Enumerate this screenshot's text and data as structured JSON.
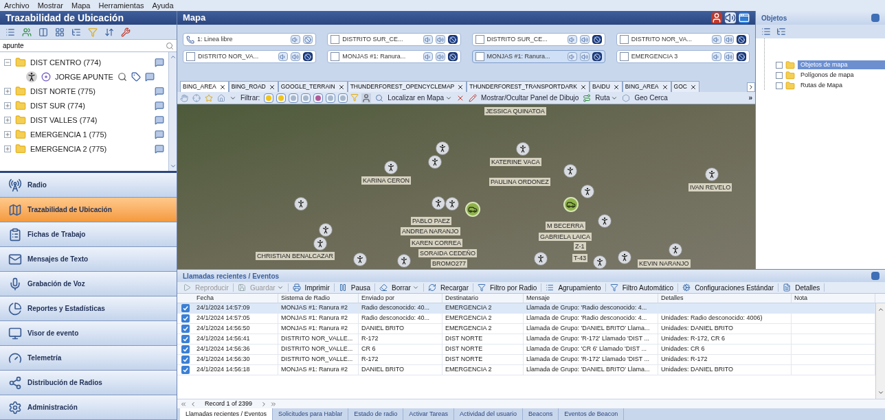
{
  "menu": [
    "Archivo",
    "Mostrar",
    "Mapa",
    "Herramientas",
    "Ayuda"
  ],
  "left_panel": {
    "title": "Trazabilidad de Ubicación",
    "search": {
      "value": "apunte"
    },
    "tree": [
      {
        "label": "DIST CENTRO (774)",
        "expanded": true,
        "children": [
          {
            "label": "JORGE APUNTE"
          }
        ]
      },
      {
        "label": "DIST NORTE (775)",
        "expanded": false
      },
      {
        "label": "DIST SUR (774)",
        "expanded": false
      },
      {
        "label": "DIST VALLES (774)",
        "expanded": false
      },
      {
        "label": "EMERGENCIA 1 (775)",
        "expanded": false
      },
      {
        "label": "EMERGENCIA 2 (775)",
        "expanded": false
      }
    ]
  },
  "nav": [
    {
      "label": "Radio",
      "selected": false
    },
    {
      "label": "Trazabilidad de Ubicación",
      "selected": true
    },
    {
      "label": "Fichas de Trabajo",
      "selected": false
    },
    {
      "label": "Mensajes de Texto",
      "selected": false
    },
    {
      "label": "Grabación de Voz",
      "selected": false
    },
    {
      "label": "Reportes y Estadísticas",
      "selected": false
    },
    {
      "label": "Visor de evento",
      "selected": false
    },
    {
      "label": "Telemetría",
      "selected": false
    },
    {
      "label": "Distribución de Radios",
      "selected": false
    },
    {
      "label": "Administración",
      "selected": false
    }
  ],
  "map_panel": {
    "title": "Mapa",
    "channels": [
      {
        "kind": "line",
        "label": "1: Linea libre",
        "selected": false
      },
      {
        "kind": "channel",
        "label": "DISTRITO SUR_CE...",
        "checked": false,
        "selected": false
      },
      {
        "kind": "channel",
        "label": "DISTRITO SUR_CE...",
        "checked": false,
        "selected": false
      },
      {
        "kind": "channel",
        "label": "DISTRITO NOR_VA...",
        "checked": false,
        "selected": false
      },
      {
        "kind": "channel",
        "label": "DISTRITO NOR_VA...",
        "checked": false,
        "selected": false
      },
      {
        "kind": "channel",
        "label": "MONJAS #1: Ranura...",
        "checked": false,
        "selected": false
      },
      {
        "kind": "channel",
        "label": "MONJAS #1: Ranura...",
        "checked": false,
        "selected": true
      },
      {
        "kind": "channel",
        "label": "EMERGENCIA 3",
        "checked": false,
        "selected": false
      }
    ],
    "tabs": [
      {
        "label": "BING_AREA",
        "selected": true
      },
      {
        "label": "BING_ROAD",
        "selected": false
      },
      {
        "label": "GOOGLE_TERRAIN",
        "selected": false
      },
      {
        "label": "THUNDERFOREST_OPENCYCLEMAP",
        "selected": false
      },
      {
        "label": "THUNDERFOREST_TRANSPORTDARK",
        "selected": false
      },
      {
        "label": "BAIDU",
        "selected": false
      },
      {
        "label": "BING_AREA",
        "selected": false
      },
      {
        "label": "GOC",
        "selected": false
      }
    ],
    "toolbar": [
      {
        "label": "Filtrar:",
        "dropdown": false
      },
      {
        "label": "Localizar en Mapa",
        "dropdown": true
      },
      {
        "label": "Mostrar/Ocultar Panel de Dibujo",
        "dropdown": false
      },
      {
        "label": "Ruta",
        "dropdown": true
      },
      {
        "label": "Geo Cerca",
        "dropdown": false
      },
      {
        "label": "»",
        "dropdown": false
      }
    ]
  },
  "map": {
    "labels": [
      "JESSICA QUINATOA",
      "KATERINE VACA",
      "KARINA CERON",
      "PAULINA ORDONEZ",
      "IVAN REVELO",
      "PABLO PAEZ",
      "ANDREA NARANJO",
      "KAREN CORREA",
      "SORAIDA CEDEÑO",
      "BROMO277",
      "M BECERRA",
      "GABRIELA LAICA",
      "Z-1",
      "T-43",
      "CHRISTIAN BENALCAZAR",
      "KEVIN NARANJO"
    ],
    "markers": [
      {
        "kind": "person"
      },
      {
        "kind": "person"
      },
      {
        "kind": "person"
      },
      {
        "kind": "person"
      },
      {
        "kind": "person"
      },
      {
        "kind": "person"
      },
      {
        "kind": "person"
      },
      {
        "kind": "person"
      },
      {
        "kind": "person"
      },
      {
        "kind": "person"
      },
      {
        "kind": "person"
      },
      {
        "kind": "person"
      },
      {
        "kind": "person"
      },
      {
        "kind": "person"
      },
      {
        "kind": "person"
      },
      {
        "kind": "person"
      },
      {
        "kind": "person"
      },
      {
        "kind": "person"
      },
      {
        "kind": "person"
      },
      {
        "kind": "vehicle"
      },
      {
        "kind": "vehicle"
      }
    ]
  },
  "objects_panel": {
    "title": "Objetos",
    "items": [
      {
        "label": "Objetos de mapa",
        "checked": false,
        "selected": true
      },
      {
        "label": "Polígonos de mapa",
        "checked": false,
        "selected": false
      },
      {
        "label": "Rutas de Mapa",
        "checked": false,
        "selected": false
      }
    ]
  },
  "events_panel": {
    "title": "Llamadas recientes / Eventos",
    "toolbar": [
      {
        "label": "Reproducir",
        "disabled": true,
        "dropdown": false
      },
      {
        "label": "Guardar",
        "disabled": true,
        "dropdown": true
      },
      {
        "label": "Imprimir",
        "disabled": false,
        "dropdown": false
      },
      {
        "label": "Pausa",
        "disabled": false,
        "dropdown": false
      },
      {
        "label": "Borrar",
        "disabled": false,
        "dropdown": true
      },
      {
        "label": "Recargar",
        "disabled": false,
        "dropdown": false
      },
      {
        "label": "Filtro por Radio",
        "disabled": false,
        "dropdown": false
      },
      {
        "label": "Agrupamiento",
        "disabled": false,
        "dropdown": false
      },
      {
        "label": "Filtro Automático",
        "disabled": false,
        "dropdown": false
      },
      {
        "label": "Configuraciones Estándar",
        "disabled": false,
        "dropdown": false
      },
      {
        "label": "Detalles",
        "disabled": false,
        "dropdown": false
      }
    ],
    "columns": [
      "Fecha",
      "Sistema de Radio",
      "Enviado por",
      "Destinatario",
      "Mensaje",
      "Detalles",
      "Nota"
    ],
    "rows": [
      {
        "selected": true,
        "cells": [
          "24/1/2024 14:57:09",
          "MONJAS #1: Ranura #2",
          "Radio desconocido: 40...",
          "EMERGENCIA 2",
          "Llamada de Grupo: 'Radio desconocido: 4..."
        ]
      },
      {
        "selected": false,
        "cells": [
          "24/1/2024 14:57:05",
          "MONJAS #1: Ranura #2",
          "Radio desconocido: 40...",
          "EMERGENCIA 2",
          "Llamada de Grupo: 'Radio desconocido: 4...",
          "Unidades: Radio desconocido: 4006)"
        ]
      },
      {
        "selected": false,
        "cells": [
          "24/1/2024 14:56:50",
          "MONJAS #1: Ranura #2",
          "DANIEL BRITO",
          "EMERGENCIA 2",
          "Llamada de Grupo: 'DANIEL BRITO' Llama...",
          "Unidades: DANIEL BRITO"
        ]
      },
      {
        "selected": false,
        "cells": [
          "24/1/2024 14:56:41",
          "DISTRITO NOR_VALLE...",
          "R-172",
          "DIST NORTE",
          "Llamada de Grupo: 'R-172' Llamado 'DIST ...",
          "Unidades: R-172, CR 6"
        ]
      },
      {
        "selected": false,
        "cells": [
          "24/1/2024 14:56:36",
          "DISTRITO NOR_VALLE...",
          "CR 6",
          "DIST NORTE",
          "Llamada de Grupo: 'CR 6' Llamado 'DIST ...",
          "Unidades: CR 6"
        ]
      },
      {
        "selected": false,
        "cells": [
          "24/1/2024 14:56:30",
          "DISTRITO NOR_VALLE...",
          "R-172",
          "DIST NORTE",
          "Llamada de Grupo: 'R-172' Llamado 'DIST ...",
          "Unidades: R-172"
        ]
      },
      {
        "selected": false,
        "cells": [
          "24/1/2024 14:56:18",
          "MONJAS #1: Ranura #2",
          "DANIEL BRITO",
          "EMERGENCIA 2",
          "Llamada de Grupo: 'DANIEL BRITO' Llama...",
          "Unidades: DANIEL BRITO"
        ]
      }
    ],
    "pager": "Record 1 of 2399",
    "tabs": [
      {
        "label": "Llamadas recientes / Eventos",
        "selected": true
      },
      {
        "label": "Solicitudes para Hablar",
        "selected": false
      },
      {
        "label": "Estado de radio",
        "selected": false
      },
      {
        "label": "Activar Tareas",
        "selected": false
      },
      {
        "label": "Actividad del usuario",
        "selected": false
      },
      {
        "label": "Beacons",
        "selected": false
      },
      {
        "label": "Eventos de Beacon",
        "selected": false
      }
    ]
  }
}
